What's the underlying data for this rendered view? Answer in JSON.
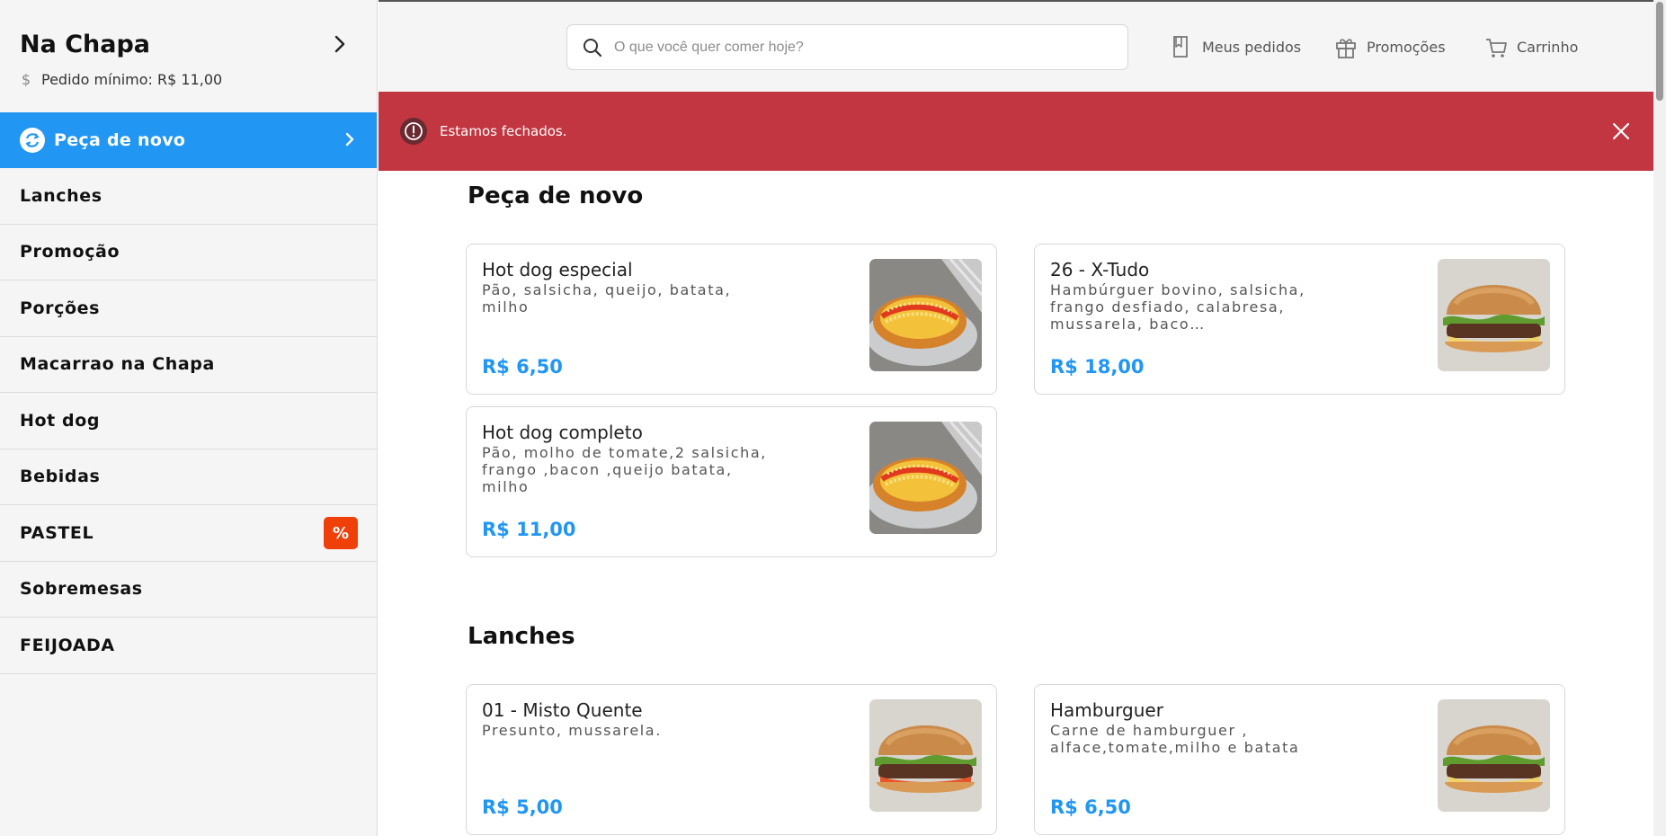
{
  "store": {
    "name": "Na Chapa",
    "min_order": "Pedido mínimo: R$ 11,00"
  },
  "sidebar": {
    "active": "Peça de novo",
    "items": [
      {
        "label": "Lanches",
        "badge": ""
      },
      {
        "label": "Promoção",
        "badge": ""
      },
      {
        "label": "Porções",
        "badge": ""
      },
      {
        "label": "Macarrao na Chapa",
        "badge": ""
      },
      {
        "label": "Hot dog",
        "badge": ""
      },
      {
        "label": "Bebidas",
        "badge": ""
      },
      {
        "label": "PASTEL",
        "badge": "%"
      },
      {
        "label": "Sobremesas",
        "badge": ""
      },
      {
        "label": "FEIJOADA",
        "badge": ""
      }
    ]
  },
  "header": {
    "search_placeholder": "O que você quer comer hoje?",
    "my_orders": "Meus pedidos",
    "promotions": "Promoções",
    "cart": "Carrinho"
  },
  "alert": {
    "text": "Estamos fechados."
  },
  "sections": [
    {
      "title": "Peça de novo",
      "products": [
        {
          "name": "Hot dog especial",
          "desc": "Pão, salsicha, queijo, batata, milho",
          "price": "R$ 6,50",
          "image": "hotdog"
        },
        {
          "name": "26 - X-Tudo",
          "desc": "Hambúrguer bovino, salsicha, frango desfiado, calabresa, mussarela, baco…",
          "price": "R$ 18,00",
          "image": "burger"
        },
        {
          "name": "Hot dog completo",
          "desc": "Pão, molho de tomate,2 salsicha, frango ,bacon ,queijo batata, milho",
          "price": "R$ 11,00",
          "image": "hotdog"
        }
      ]
    },
    {
      "title": "Lanches",
      "products": [
        {
          "name": "01 - Misto Quente",
          "desc": "Presunto, mussarela.",
          "price": "R$ 5,00",
          "image": "burger"
        },
        {
          "name": "Hamburguer",
          "desc": "Carne de hamburguer , alface,tomate,milho e batata",
          "price": "R$ 6,50",
          "image": "burger"
        }
      ]
    }
  ],
  "colors": {
    "accent": "#2196f3",
    "alert": "#c23641",
    "badge": "#f0400a"
  }
}
